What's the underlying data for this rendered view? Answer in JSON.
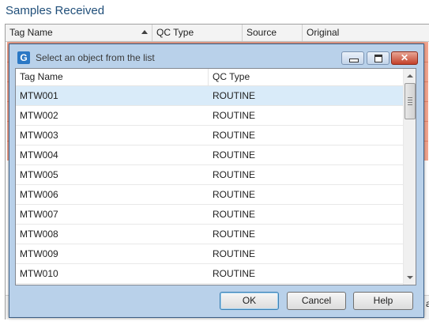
{
  "background": {
    "title": "Samples Received",
    "columns": [
      "Tag Name",
      "QC Type",
      "Source",
      "Original"
    ],
    "fragment": "alt"
  },
  "dialog": {
    "title": "Select an object from the list",
    "app_icon": "G",
    "icons": {
      "app": "app-g-icon",
      "minimize": "minimize-icon",
      "maximize": "maximize-icon",
      "close": "close-icon"
    },
    "columns": [
      "Tag Name",
      "QC Type"
    ],
    "rows": [
      {
        "tag": "MTW001",
        "qc": "ROUTINE"
      },
      {
        "tag": "MTW002",
        "qc": "ROUTINE"
      },
      {
        "tag": "MTW003",
        "qc": "ROUTINE"
      },
      {
        "tag": "MTW004",
        "qc": "ROUTINE"
      },
      {
        "tag": "MTW005",
        "qc": "ROUTINE"
      },
      {
        "tag": "MTW006",
        "qc": "ROUTINE"
      },
      {
        "tag": "MTW007",
        "qc": "ROUTINE"
      },
      {
        "tag": "MTW008",
        "qc": "ROUTINE"
      },
      {
        "tag": "MTW009",
        "qc": "ROUTINE"
      },
      {
        "tag": "MTW010",
        "qc": "ROUTINE"
      }
    ],
    "buttons": {
      "ok": "OK",
      "cancel": "Cancel",
      "help": "Help"
    }
  },
  "colors": {
    "accent": "#1f4e79",
    "selection": "#d9ebf9",
    "highlight_rows": "#f4a58f",
    "dialog_frame": "#b9d1ea"
  }
}
